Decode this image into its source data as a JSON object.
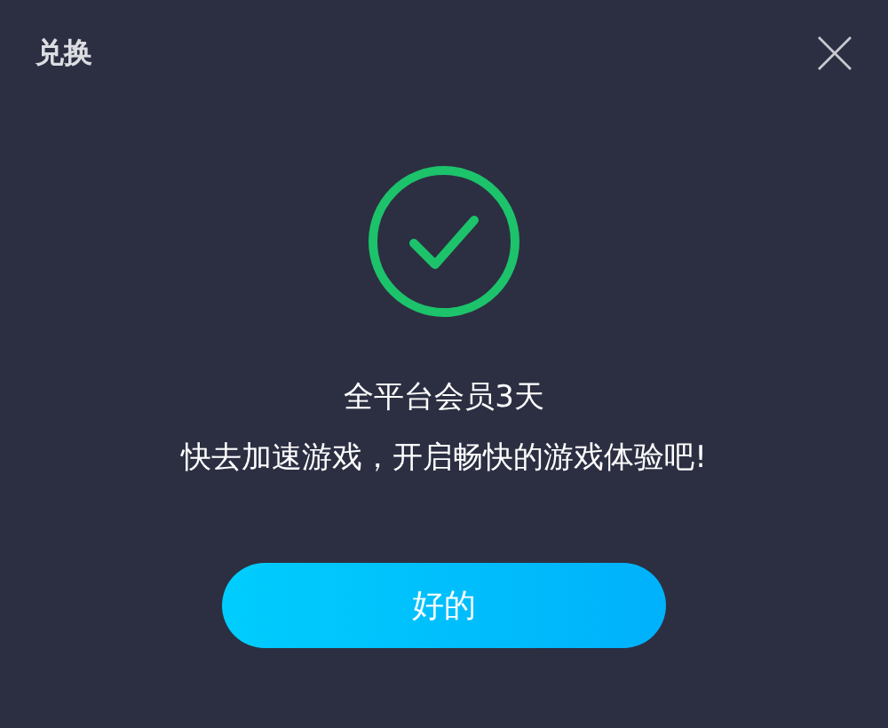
{
  "window": {
    "title": "兑换"
  },
  "message": {
    "title": "全平台会员3天",
    "body": "快去加速游戏，开启畅快的游戏体验吧!"
  },
  "buttons": [
    "好的"
  ]
}
